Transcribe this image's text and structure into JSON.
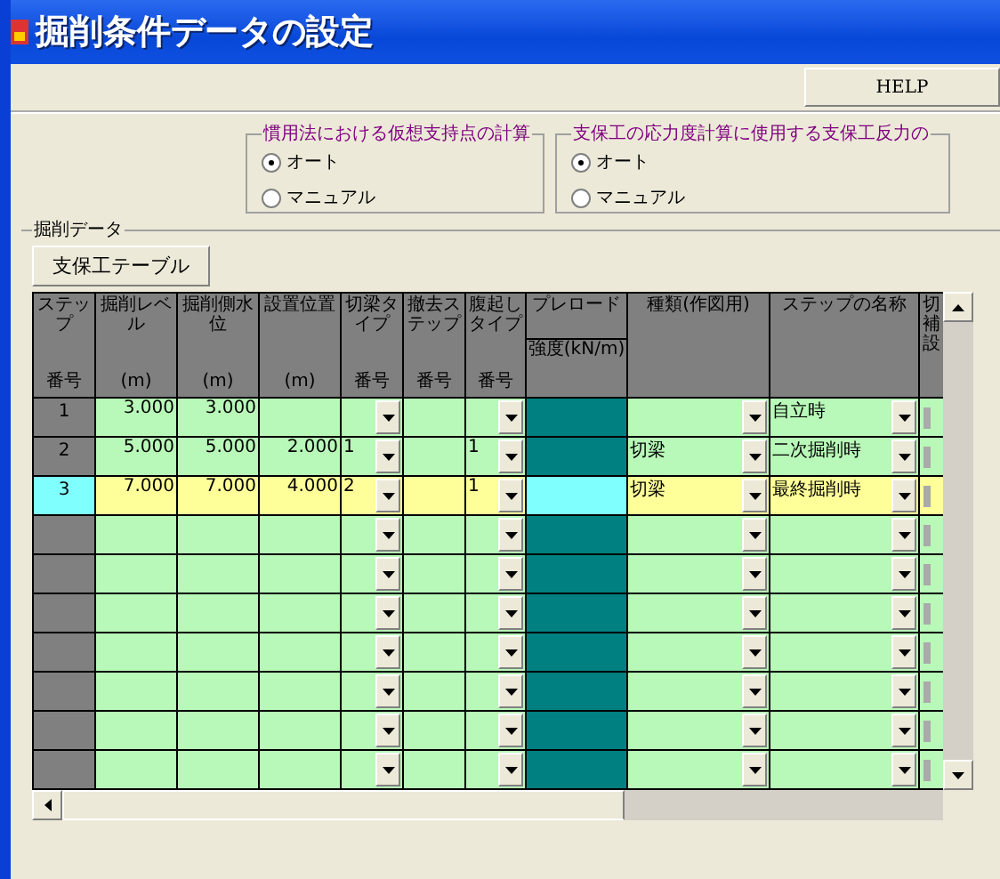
{
  "window": {
    "title": "掘削条件データの設定"
  },
  "toolbar": {
    "help_button": "HELP"
  },
  "radio_groups": [
    {
      "title": "慣用法における仮想支持点の計算",
      "options": [
        {
          "label": "オート",
          "selected": true
        },
        {
          "label": "マニュアル",
          "selected": false
        }
      ]
    },
    {
      "title": "支保工の応力度計算に使用する支保工反力の",
      "options": [
        {
          "label": "オート",
          "selected": true
        },
        {
          "label": "マニュアル",
          "selected": false
        }
      ]
    }
  ],
  "excavation_data": {
    "title": "掘削データ",
    "table_button": "支保工テーブル",
    "columns": [
      {
        "kind": "step",
        "top": "ステップ",
        "bottom": "番号"
      },
      {
        "kind": "number",
        "top": "掘削レベル",
        "bottom": "(m)"
      },
      {
        "kind": "number",
        "top": "掘削側水位",
        "bottom": "(m)"
      },
      {
        "kind": "number",
        "top": "設置位置",
        "bottom": "(m)"
      },
      {
        "kind": "dropdown",
        "top": "切梁タイプ",
        "bottom": "番号"
      },
      {
        "kind": "plain",
        "top": "撤去ステップ",
        "bottom": "番号"
      },
      {
        "kind": "dropdown",
        "top": "腹起しタイプ",
        "bottom": "番号"
      },
      {
        "kind": "preload",
        "top": "プレロード",
        "bottom": "強度(kN/m)"
      },
      {
        "kind": "dropdown",
        "top": "種類(作図用)"
      },
      {
        "kind": "dropdown",
        "top": "ステップの名称"
      },
      {
        "kind": "check",
        "top": "切補設"
      }
    ],
    "rows": [
      {
        "selected": false,
        "cells": [
          "1",
          "3.000",
          "3.000",
          "",
          "",
          "",
          "",
          "",
          "",
          "自立時",
          ""
        ]
      },
      {
        "selected": false,
        "cells": [
          "2",
          "5.000",
          "5.000",
          "2.000",
          "1",
          "",
          "1",
          "",
          "切梁",
          "二次掘削時",
          ""
        ]
      },
      {
        "selected": true,
        "cells": [
          "3",
          "7.000",
          "7.000",
          "4.000",
          "2",
          "",
          "1",
          "",
          "切梁",
          "最終掘削時",
          ""
        ]
      },
      {
        "selected": false
      },
      {
        "selected": false
      },
      {
        "selected": false
      },
      {
        "selected": false
      },
      {
        "selected": false
      },
      {
        "selected": false
      },
      {
        "selected": false
      }
    ]
  }
}
